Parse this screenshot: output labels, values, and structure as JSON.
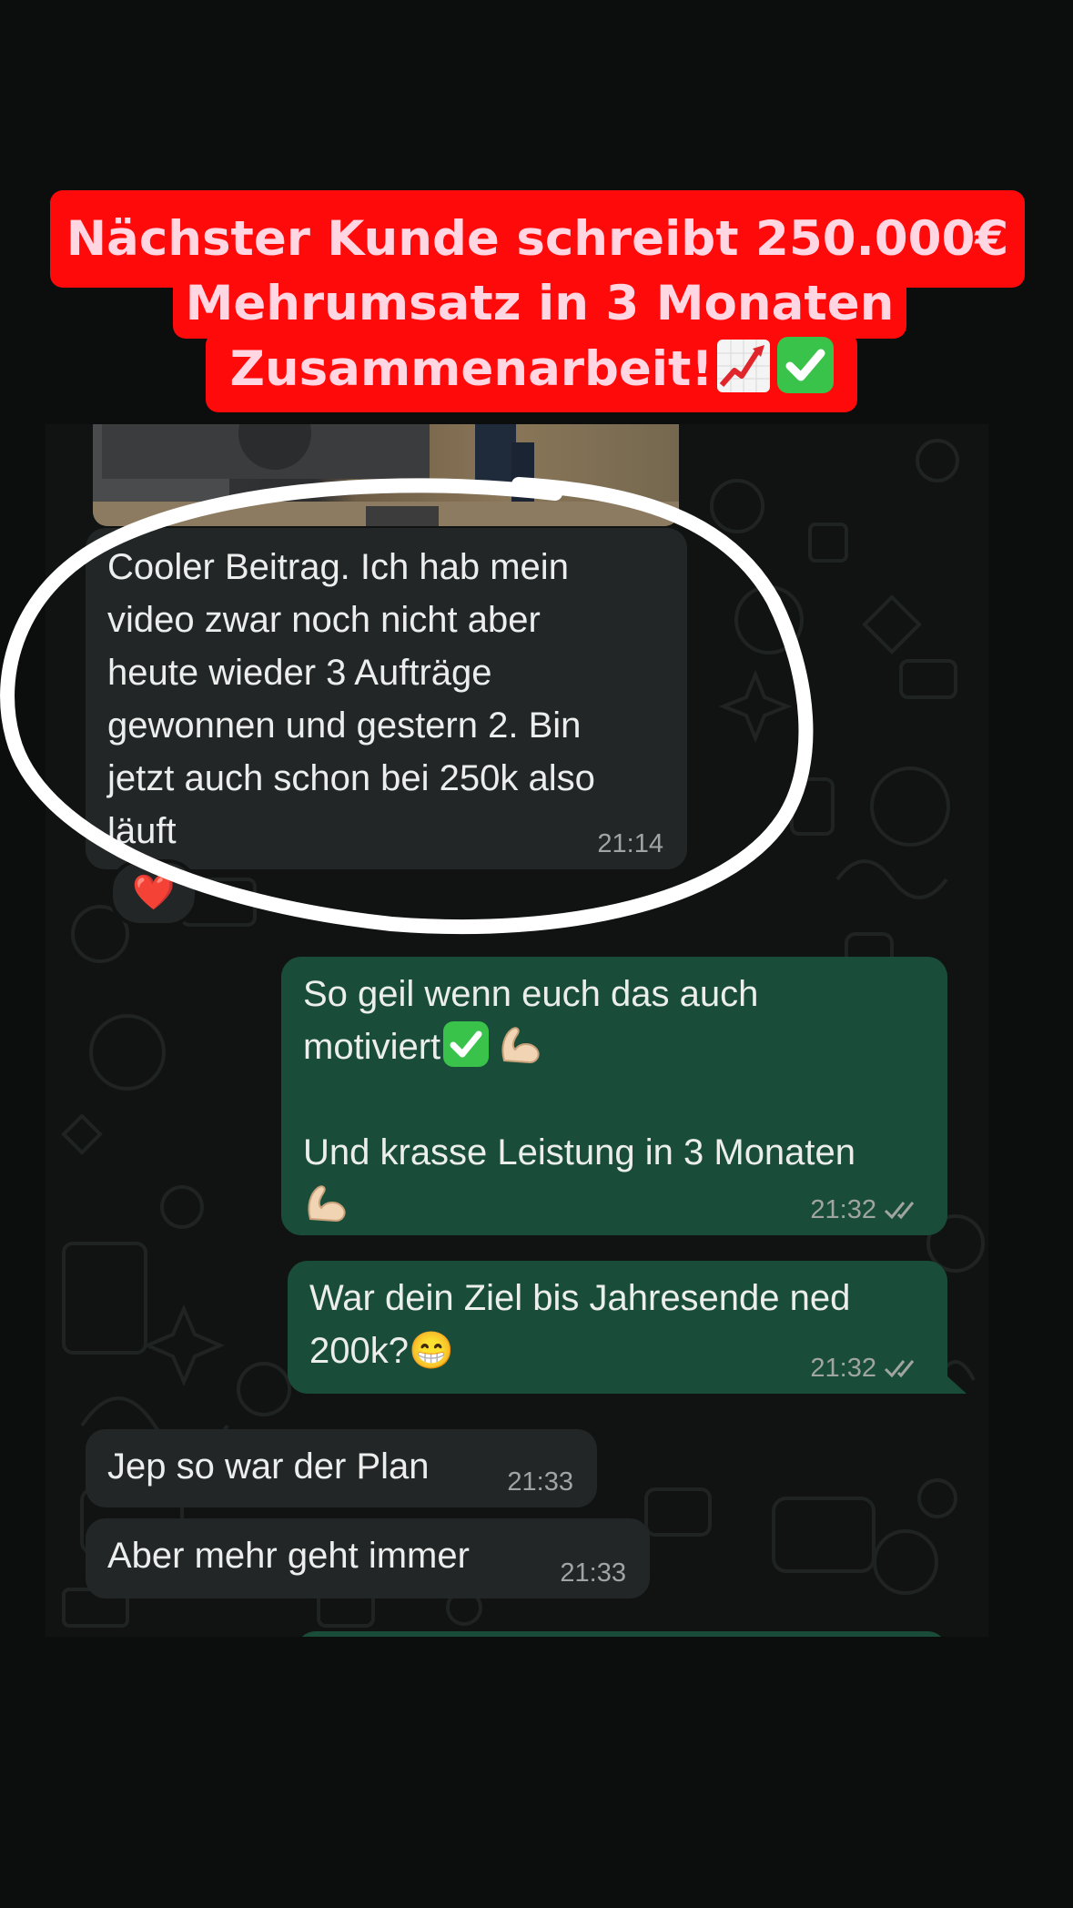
{
  "headline": {
    "line1": "Nächster Kunde schreibt 250.000€",
    "line2": "Mehrumsatz in 3 Monaten",
    "line3": "Zusammenarbeit!",
    "icons": [
      "chart-increasing-icon",
      "check-mark-button-icon"
    ]
  },
  "chat": {
    "messages": [
      {
        "direction": "incoming",
        "lines": [
          "Cooler Beitrag.  Ich hab mein",
          "video zwar noch nicht aber",
          "heute wieder 3 Aufträge",
          "gewonnen und gestern 2. Bin",
          "jetzt auch schon bei 250k also",
          "läuft"
        ],
        "time": "21:14",
        "reaction": "❤️"
      },
      {
        "direction": "outgoing",
        "line1": "So geil wenn euch das auch",
        "line2": "motiviert",
        "line3": "Und krasse Leistung in 3 Monaten",
        "time": "21:32",
        "status": "read"
      },
      {
        "direction": "outgoing",
        "line1": "War dein Ziel bis Jahresende ned",
        "line2": "200k?",
        "emoji": "😁",
        "time": "21:32",
        "status": "read"
      },
      {
        "direction": "incoming",
        "text": "Jep so war der Plan",
        "time": "21:33"
      },
      {
        "direction": "incoming",
        "text": "Aber mehr geht immer",
        "time": "21:33"
      }
    ]
  },
  "colors": {
    "banner": "#ff0a0a",
    "banner_text": "#ffd6e2",
    "incoming_bubble": "#232626",
    "outgoing_bubble": "#1a4d39",
    "read_ticks": "#a0a5a3",
    "highlight_circle": "#ffffff"
  }
}
